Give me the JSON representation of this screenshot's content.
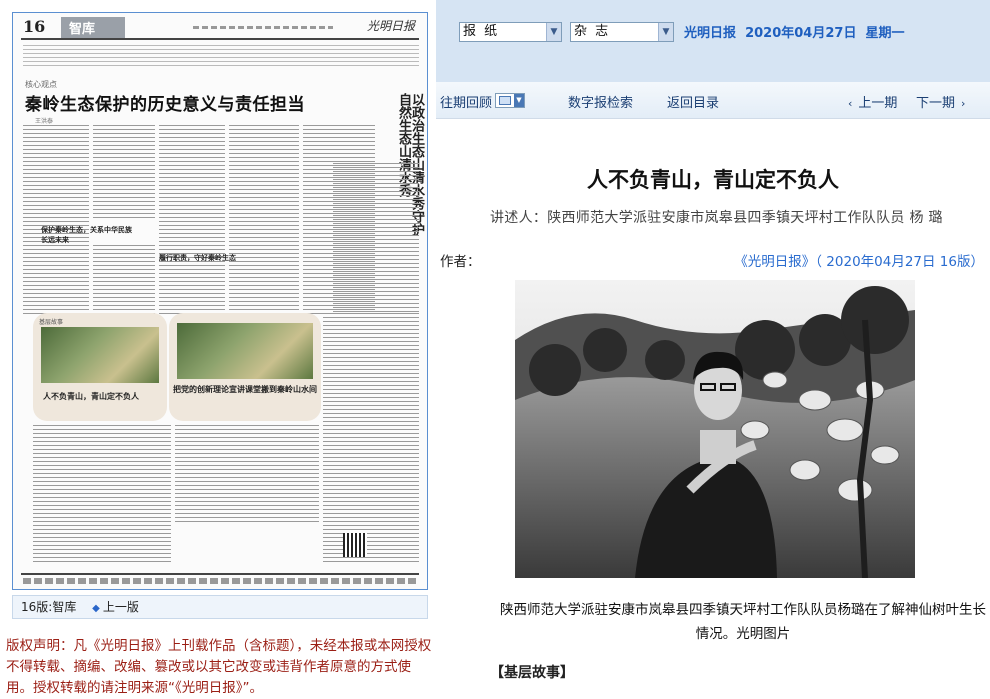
{
  "paper": {
    "page_number": "16",
    "section_tab": "智库",
    "masthead": "光明日报",
    "kicker": "核心观点",
    "headline": "秦岭生态保护的历史意义与责任担当",
    "byline": "王洪泰",
    "vertical_headline": "以政治生态山清水秀守护自然生态山清水秀",
    "subhead_1": "保护秦岭生态，关系中华民族长远未来",
    "subhead_2": "履行职责，守好秦岭生态",
    "story_kicker": "基层故事",
    "story_left_title": "人不负青山，青山定不负人",
    "story_right_title": "把党的创新理论宣讲课堂搬到秦岭山水间"
  },
  "page_nav": {
    "current": "16版:智库",
    "prev": "上一版"
  },
  "copyright": "版权声明：凡《光明日报》上刊载作品（含标题），未经本报或本网授权不得转载、摘编、改编、篡改或以其它改变或违背作者原意的方式使用。授权转载的请注明来源“《光明日报》”。",
  "toolbar": {
    "newspaper_select": "报 纸",
    "magazine_select": "杂 志",
    "pub_name": "光明日报",
    "date": "2020年04月27日",
    "weekday": "星期一"
  },
  "nav": {
    "past": "往期回顾",
    "search": "数字报检索",
    "back": "返回目录",
    "prev": "上一期",
    "next": "下一期",
    "prev_icon": "‹",
    "next_icon": "›"
  },
  "article": {
    "title": "人不负青山，青山定不负人",
    "subtitle": "讲述人：陕西师范大学派驻安康市岚皋县四季镇天坪村工作队队员  杨  璐",
    "author_label": "作者：",
    "source": "《光明日报》（ 2020年04月27日   16版）",
    "caption": "陕西师范大学派驻安康市岚皋县四季镇天坪村工作队队员杨璐在了解神仙树叶生长情况。光明图片",
    "section": "【基层故事】"
  },
  "colors": {
    "topbar_bg": "#d6e4f3",
    "link_blue": "#2a6ccf",
    "copyright_red": "#9b1f15"
  }
}
